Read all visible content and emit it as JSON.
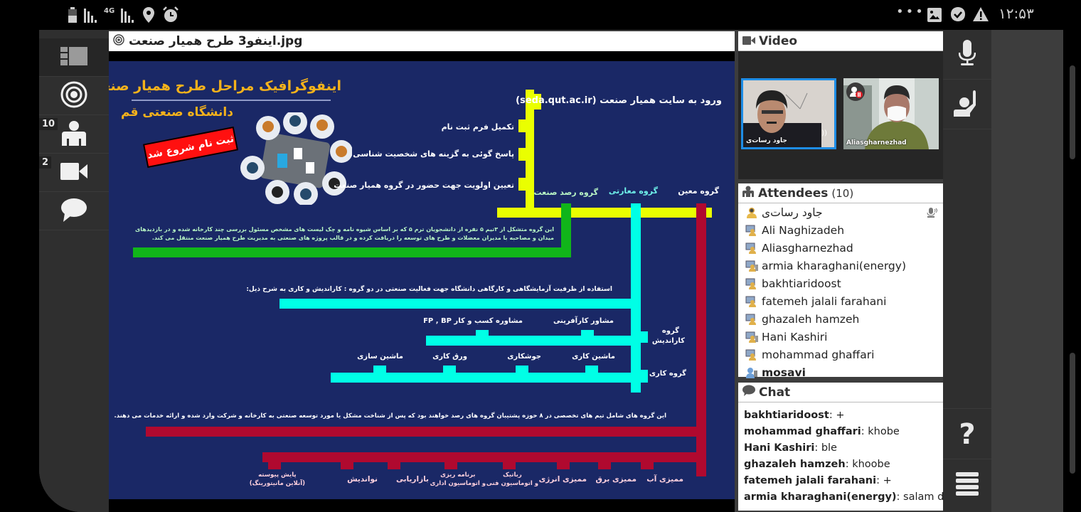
{
  "status_bar": {
    "network": "4G",
    "time": "۱۲:۵۳",
    "more": "•••"
  },
  "presentation": {
    "file_name": "اینفو3 طرح همیار صنعت.jpg",
    "slide": {
      "title_line1": "اینفوگرافیک مراحل طرح همیار صنعت",
      "title_line2": "دانشگاه صنعتی قم",
      "register_badge": "ثبت نام شروع شد",
      "steps": [
        "ورود به سایت همیار صنعت (seda.qut.ac.ir)",
        "تکمیل فرم ثبت نام",
        "پاسخ گوئی به گزینه های شخصیت شناسی",
        "تعیین اولویت جهت حضور در گروه همیار صنعت"
      ],
      "groups": {
        "rasad": "گروه رصد صنعت",
        "meamari": "گروه معارتی",
        "moein": "گروه معین"
      },
      "rasad_desc_line1": "این گروه متشکل از ۳تیم ۵ نفره از دانشجویان ترم ۵ که بر اساس شیوه نامه و چک لیست های مشخص مسئول بررسی چند کارخانه شده و در بازدیدهای",
      "rasad_desc_line2": "میدان و مصاحبه با مدیران معضلات و طرح های توسعه را دریافت کرده و در قالب پروژه های صنعتی به مدیریت طرح همیار صنعت منتقل می کند.",
      "meamari_desc": "استفاده از ظرفیت آزمایشگاهی و کارگاهی دانشگاه جهت فعالیت صنعتی در دو گروه : کاراندیش و کاری به شرح ذیل:",
      "karandish_label_1": "گروه",
      "karandish_label_2": "کاراندیش",
      "karandish_items": [
        "مشاور کارآفرینی",
        "مشاوره کسب و کار FP , BP"
      ],
      "kari_label": "گروه کاری",
      "kari_items": [
        "ماشین کاری",
        "جوشکاری",
        "ورق کاری",
        "ماشین سازی"
      ],
      "moein_desc": "این گروه های شامل تیم های تخصصی در ۸ حوزه پشتیبان گروه های رصد خواهند بود که پس از شناخت مشکل یا مورد توسعه صنعتی به کارخانه و شرکت وارد شده و ارائه خدمات می دهند.",
      "moein_items": [
        {
          "l1": "ممیزی آب",
          "l2": ""
        },
        {
          "l1": "ممیزی برق",
          "l2": ""
        },
        {
          "l1": "ممیزی انرژی",
          "l2": ""
        },
        {
          "l1": "رباتیک",
          "l2": "و اتوماسیون فنی"
        },
        {
          "l1": "برنامه ریزی",
          "l2": "و اتوماسیون اداری"
        },
        {
          "l1": "بازاریابی",
          "l2": ""
        },
        {
          "l1": "نواندیش",
          "l2": ""
        },
        {
          "l1": "پایش پیوسته",
          "l2": "(آنلاین مانیتورینگ)"
        }
      ]
    }
  },
  "left_nav": {
    "attendees_count": "10",
    "video_count": "2"
  },
  "video": {
    "title": "Video",
    "tiles": [
      {
        "name": "جاود رسات‌ی",
        "active": true
      },
      {
        "name": "Aliasgharnezhad",
        "active": false
      }
    ]
  },
  "attendees": {
    "title": "Attendees",
    "count": "(10)",
    "list": [
      "جاود رسات‌ی",
      "Ali Naghizadeh",
      "Aliasgharnezhad",
      "armia kharaghani(energy)",
      "bakhtiaridoost",
      "fatemeh jalali farahani",
      "ghazaleh hamzeh",
      "Hani Kashiri",
      "mohammad ghaffari",
      "mosavi"
    ]
  },
  "chat": {
    "title": "Chat",
    "messages": [
      {
        "from": "bakhtiaridoost",
        "text": "+"
      },
      {
        "from": "mohammad ghaffari",
        "text": "khobe"
      },
      {
        "from": "Hani Kashiri",
        "text": "ble"
      },
      {
        "from": "ghazaleh hamzeh",
        "text": "khoobe"
      },
      {
        "from": "fatemeh jalali farahani",
        "text": "+"
      },
      {
        "from": "armia kharaghani(energy)",
        "text": "salam dostan"
      }
    ]
  },
  "right_nav": {
    "help": "?"
  }
}
